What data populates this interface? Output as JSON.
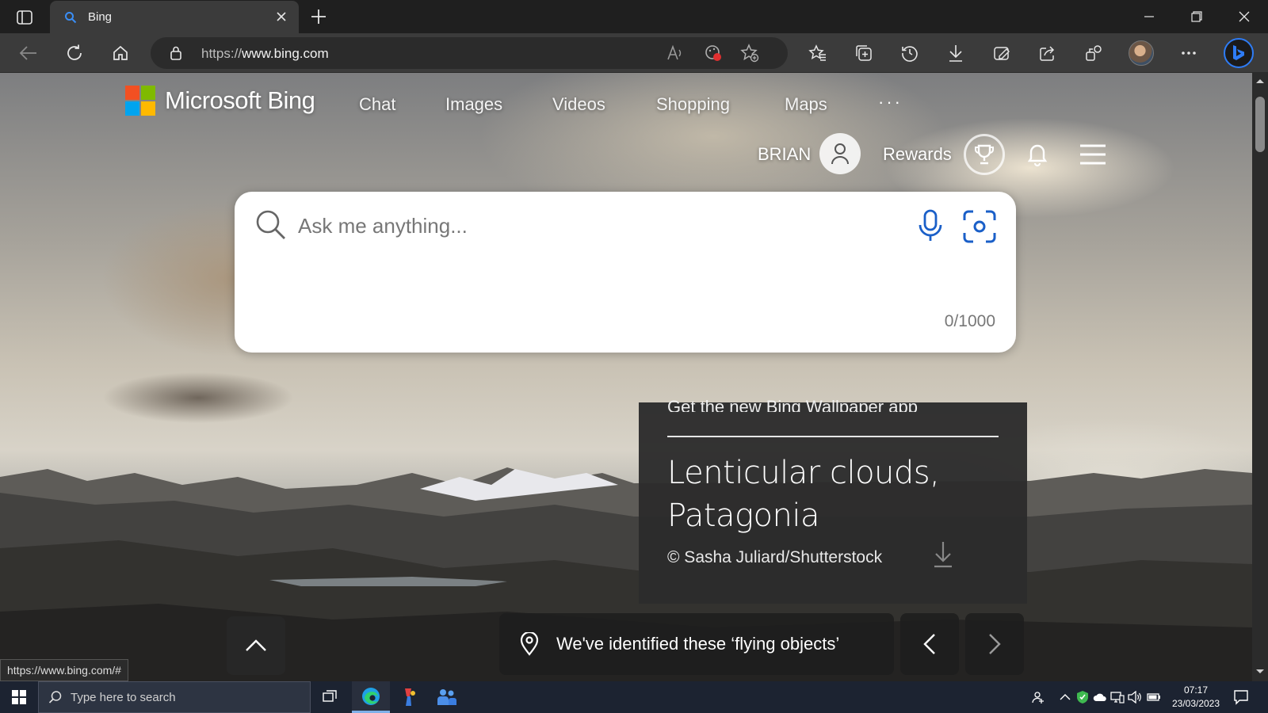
{
  "browser": {
    "tab_title": "Bing",
    "url_prefix": "https://",
    "url_host": "www.bing.com",
    "status_url": "https://www.bing.com/#"
  },
  "bing": {
    "brand": "Microsoft Bing",
    "nav": [
      "Chat",
      "Images",
      "Videos",
      "Shopping",
      "Maps"
    ],
    "more": "···",
    "user_name": "BRIAN",
    "rewards_label": "Rewards",
    "search_placeholder": "Ask me anything...",
    "char_counter": "0/1000"
  },
  "image_card": {
    "promo": "Get the new Bing Wallpaper app",
    "title": "Lenticular clouds, Patagonia",
    "credit": "© Sasha Juliard/Shutterstock"
  },
  "news": {
    "headline": "We've identified these ‘flying objects’"
  },
  "taskbar": {
    "search_placeholder": "Type here to search",
    "time": "07:17",
    "date": "23/03/2023"
  },
  "colors": {
    "ms_red": "#f25022",
    "ms_green": "#7fba00",
    "ms_blue": "#00a4ef",
    "ms_yellow": "#ffb900",
    "bing_accent": "#2e7cf6",
    "search_icon_blue": "#1a5fc8"
  },
  "icons": [
    "tab-actions-icon",
    "search-favicon",
    "close-icon",
    "plus-icon",
    "minimize-icon",
    "restore-icon",
    "back-icon",
    "refresh-icon",
    "home-icon",
    "lock-icon",
    "read-aloud-icon",
    "tracking-icon",
    "add-favorite-icon",
    "favorites-icon",
    "collections-icon",
    "history-icon",
    "download-icon",
    "screenshot-icon",
    "share-icon",
    "extensions-icon",
    "more-icon",
    "bing-chat-icon",
    "user-icon",
    "trophy-icon",
    "bell-icon",
    "menu-icon",
    "search-icon",
    "microphone-icon",
    "visual-search-icon",
    "download-image-icon",
    "chevron-up-icon",
    "location-pin-icon",
    "chevron-left-icon",
    "chevron-right-icon",
    "windows-icon",
    "task-view-icon",
    "edge-icon",
    "teams-icon"
  ]
}
